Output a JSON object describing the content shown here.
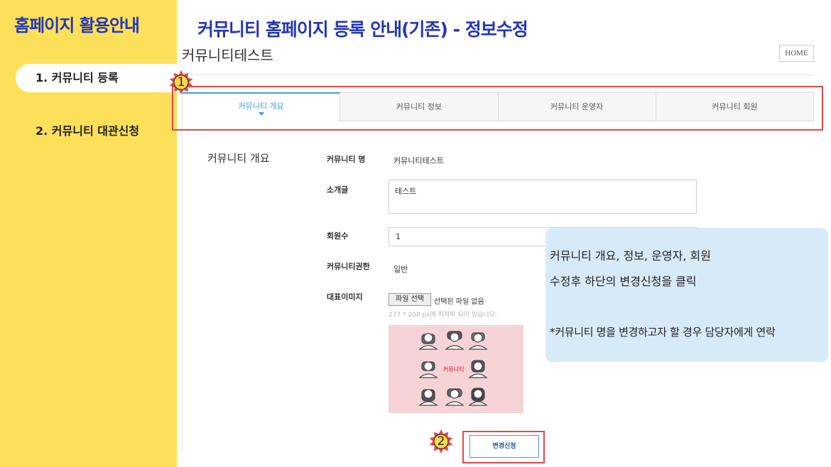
{
  "sidebar": {
    "title": "홈페이지 활용안내",
    "items": [
      {
        "label": "1. 커뮤니티 등록",
        "selected": true
      },
      {
        "label": "2. 커뮤니티 대관신청",
        "selected": false
      }
    ]
  },
  "header": {
    "heading": "커뮤니티 홈페이지 등록 안내(기존) - 정보수정",
    "community_name": "커뮤니티테스트",
    "home_label": "HOME"
  },
  "tabs": [
    {
      "label": "커뮤니티 개요",
      "active": true
    },
    {
      "label": "커뮤니티 정보",
      "active": false
    },
    {
      "label": "커뮤니티 운영자",
      "active": false
    },
    {
      "label": "커뮤니티 회원",
      "active": false
    }
  ],
  "badges": {
    "tabs": "1",
    "submit": "2"
  },
  "form": {
    "section_title": "커뮤니티 개요",
    "name_label": "커뮤니티 명",
    "name_value": "커뮤니티테스트",
    "intro_label": "소개글",
    "intro_value": "테스트",
    "members_label": "회원수",
    "members_value": "1",
    "permission_label": "커뮤니티권한",
    "permission_value": "일반",
    "image_label": "대표이미지",
    "file_button": "파일 선택",
    "file_status": "선택된 파일 없음",
    "file_hint": "277 * 208 px에 최적화 되어 있습니다.",
    "image_caption": "커뮤니티",
    "submit_label": "변경신청"
  },
  "callout": {
    "line1": "커뮤니티 개요, 정보, 운영자, 회원",
    "line2": "수정후 하단의 변경신청을 클릭",
    "line3": "*커뮤니티 명을 변경하고자 할 경우 담당자에게 연락"
  },
  "colors": {
    "sidebar_bg": "#fde05a",
    "heading_blue": "#2436b8",
    "tab_active": "#3ea0de",
    "highlight_red": "#e04848",
    "callout_bg": "#d7eaf8"
  }
}
